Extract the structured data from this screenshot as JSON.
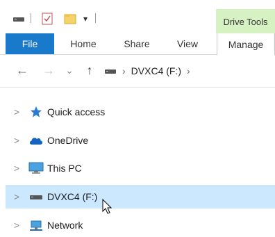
{
  "qat": {
    "customize_glyph": "▾",
    "icons": [
      "drive-icon",
      "properties-icon",
      "new-folder-icon",
      "customize-dropdown-icon"
    ]
  },
  "contextual_tab_group": {
    "label": "Drive Tools",
    "color": "#d7f2c2"
  },
  "ribbon": {
    "tabs": [
      {
        "label": "File",
        "active": true
      },
      {
        "label": "Home"
      },
      {
        "label": "Share"
      },
      {
        "label": "View"
      },
      {
        "label": "Manage"
      }
    ],
    "file_tab_color": "#1979ca"
  },
  "address_bar": {
    "back_glyph": "←",
    "forward_glyph": "→",
    "recent_glyph": "⌄",
    "up_glyph": "↑",
    "separator_glyph": "›",
    "path": [
      "DVXC4 (F:)"
    ],
    "trailing_glyph": "›"
  },
  "tree": {
    "expand_glyph": ">",
    "items": [
      {
        "label": "Quick access",
        "icon": "star-icon"
      },
      {
        "label": "OneDrive",
        "icon": "cloud-icon"
      },
      {
        "label": "This PC",
        "icon": "monitor-icon"
      },
      {
        "label": "DVXC4 (F:)",
        "icon": "drive-icon",
        "selected": true
      },
      {
        "label": "Network",
        "icon": "network-icon"
      }
    ],
    "selected_color": "#cce8ff"
  }
}
